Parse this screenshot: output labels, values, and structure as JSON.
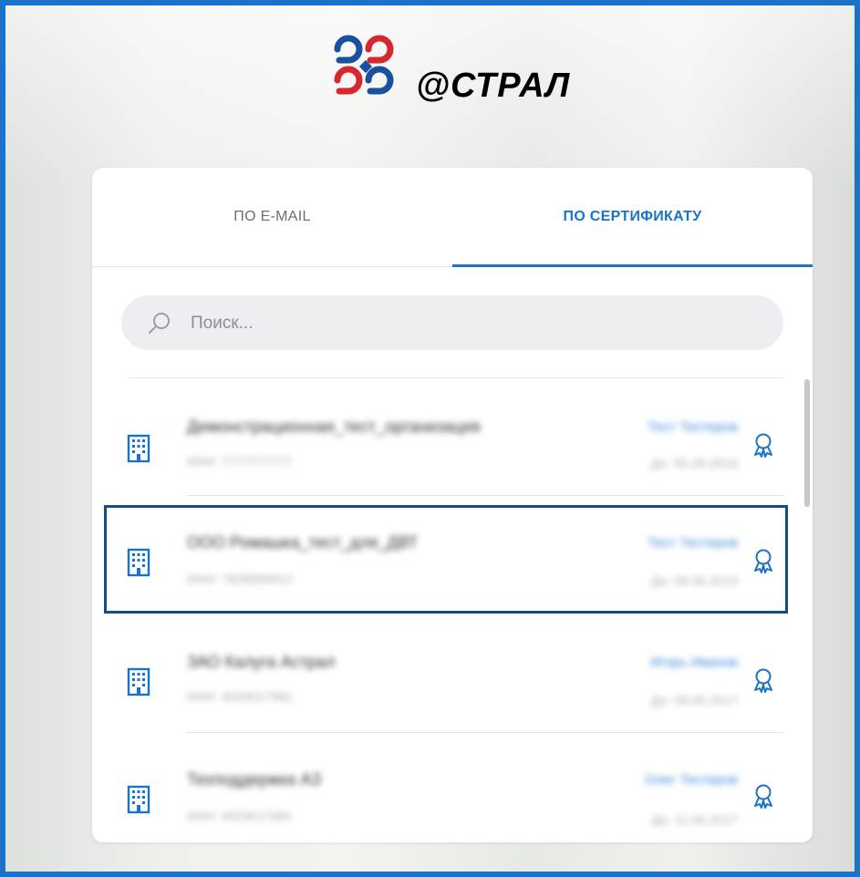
{
  "app": {
    "logo_text": "@СТРАЛ",
    "accent_color": "#1a73c8",
    "logo_colors": [
      "#d6262e",
      "#1b4fa0"
    ]
  },
  "tabs": [
    {
      "label": "ПО E-MAIL",
      "active": false
    },
    {
      "label": "ПО СЕРТИФИКАТУ",
      "active": true
    }
  ],
  "search": {
    "placeholder": "Поиск...",
    "value": "",
    "icon": "search-icon"
  },
  "certificates": [
    {
      "name": "Демонстрационная_тест_организация",
      "sub": "ИНН: 7777777777",
      "type": "Тест Тестеров",
      "date": "До: 05.05.2019",
      "icon": "building-icon",
      "badge": "award-icon",
      "selected": false
    },
    {
      "name": "ООО Ромашка_тест_для_ДВТ",
      "sub": "ИНН: 7828999912",
      "type": "Тест Тестеров",
      "date": "До: 09.06.2019",
      "icon": "building-icon",
      "badge": "award-icon",
      "selected": true
    },
    {
      "name": "ЗАО Калуга Астрал",
      "sub": "ИНН: 4029017981",
      "type": "Игорь Иванов",
      "date": "До: 09.05.2017",
      "icon": "building-icon",
      "badge": "award-icon",
      "selected": false
    },
    {
      "name": "Техподдержка АЗ",
      "sub": "ИНН: 4029017981",
      "type": "Олег Тестеров",
      "date": "До: 11.06.2017",
      "icon": "building-icon",
      "badge": "award-icon",
      "selected": false
    }
  ]
}
